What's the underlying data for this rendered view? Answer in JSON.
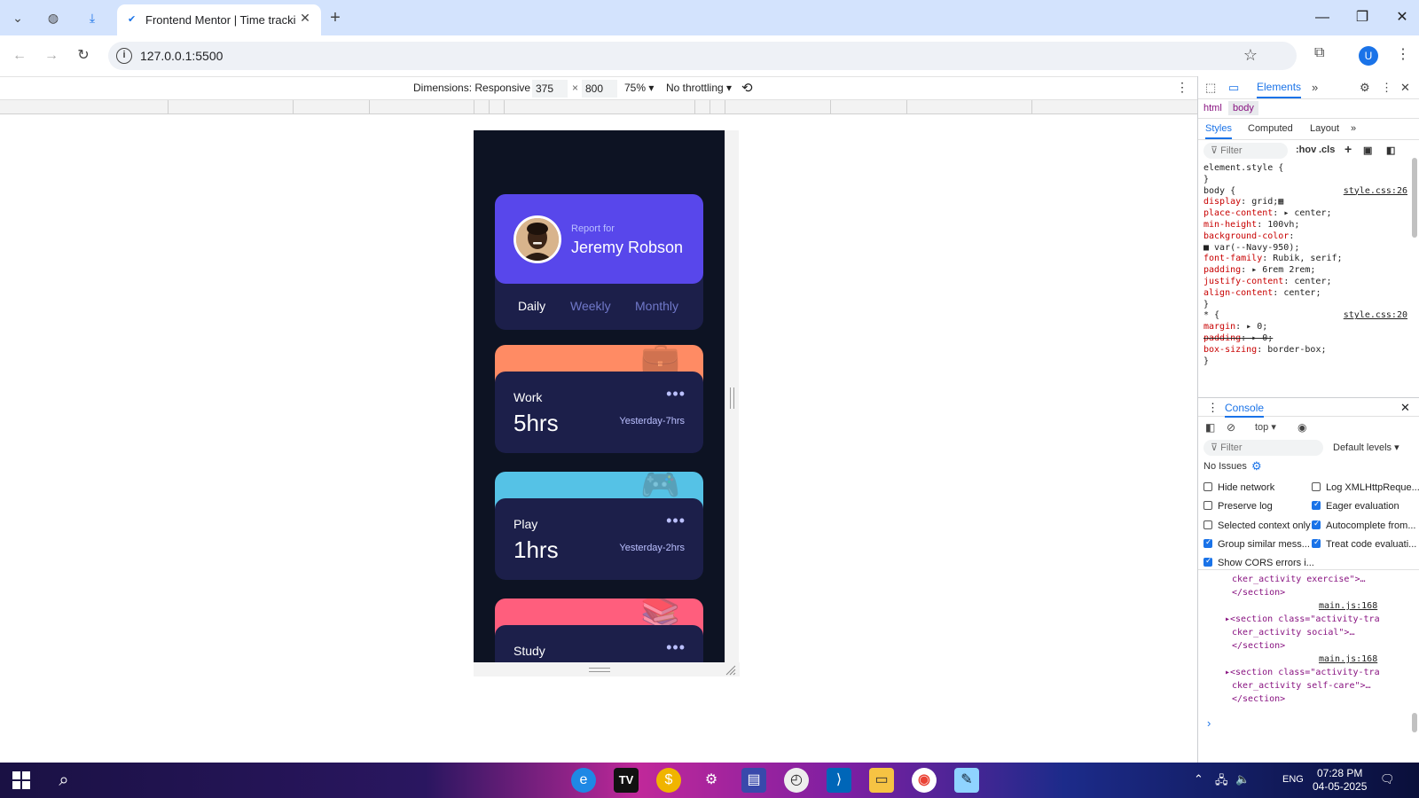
{
  "browser": {
    "tab_title": "Frontend Mentor | Time tracking",
    "url": "127.0.0.1:5500",
    "profile_initial": "U"
  },
  "device_toolbar": {
    "dimensions_label": "Dimensions: Responsive",
    "width": "375",
    "times": "×",
    "height": "800",
    "zoom": "75%",
    "throttling": "No throttling"
  },
  "app": {
    "report_for": "Report for",
    "user_name": "Jeremy Robson",
    "periods": [
      "Daily",
      "Weekly",
      "Monthly"
    ],
    "active_period": "Daily",
    "activities": [
      {
        "name": "Work",
        "hours": "5hrs",
        "previous": "Yesterday-7hrs",
        "color": "#ff8b64",
        "icon": "briefcase-icon"
      },
      {
        "name": "Play",
        "hours": "1hrs",
        "previous": "Yesterday-2hrs",
        "color": "#55c2e6",
        "icon": "gamepad-icon"
      },
      {
        "name": "Study",
        "hours": "",
        "previous": "",
        "color": "#ff5e7d",
        "icon": "book-icon"
      }
    ],
    "colors": {
      "background": "#0d1323",
      "card": "#1c1f4a",
      "accent": "#5847eb"
    }
  },
  "devtools": {
    "panel_tab": "Elements",
    "breadcrumbs": [
      "html",
      "body"
    ],
    "sub_tabs": [
      "Styles",
      "Computed",
      "Layout"
    ],
    "filter_placeholder": "Filter",
    "hov": ":hov",
    "cls": ".cls",
    "css_lines": [
      {
        "text": "element.style {",
        "src": ""
      },
      {
        "text": "}",
        "src": ""
      },
      {
        "text": "body {",
        "src": "style.css:26"
      },
      {
        "text": "  display: grid;▦",
        "src": ""
      },
      {
        "text": "  place-content: ▸ center;",
        "src": ""
      },
      {
        "text": "  min-height: 100vh;",
        "src": ""
      },
      {
        "text": "  background-color:",
        "src": ""
      },
      {
        "text": "    ■ var(--Navy-950);",
        "src": ""
      },
      {
        "text": "  font-family: Rubik, serif;",
        "src": ""
      },
      {
        "text": "  padding: ▸ 6rem 2rem;",
        "src": ""
      },
      {
        "text": "  justify-content: center;",
        "src": ""
      },
      {
        "text": "  align-content: center;",
        "src": ""
      },
      {
        "text": "}",
        "src": ""
      },
      {
        "text": "* {",
        "src": "style.css:20"
      },
      {
        "text": "  margin: ▸ 0;",
        "src": ""
      },
      {
        "text": "  padding: ▸ 0;",
        "src": ""
      },
      {
        "text": "  box-sizing: border-box;",
        "src": ""
      },
      {
        "text": "}",
        "src": ""
      }
    ],
    "console": {
      "title": "Console",
      "context": "top",
      "filter_placeholder": "Filter",
      "levels": "Default levels",
      "no_issues": "No Issues",
      "options_left": [
        {
          "label": "Hide network",
          "checked": false
        },
        {
          "label": "Preserve log",
          "checked": false
        },
        {
          "label": "Selected context only",
          "checked": false
        },
        {
          "label": "Group similar mess...",
          "checked": true
        },
        {
          "label": "Show CORS errors i...",
          "checked": true
        }
      ],
      "options_right": [
        {
          "label": "Log XMLHttpReque...",
          "checked": false
        },
        {
          "label": "Eager evaluation",
          "checked": true
        },
        {
          "label": "Autocomplete from...",
          "checked": true
        },
        {
          "label": "Treat code evaluati...",
          "checked": true
        }
      ],
      "log": [
        {
          "text": "cker_activity exercise\">…",
          "src": ""
        },
        {
          "text": "</section>",
          "src": ""
        },
        {
          "text": "",
          "src": "main.js:168"
        },
        {
          "text": "▸<section class=\"activity-tra",
          "src": ""
        },
        {
          "text": "cker_activity social\">…",
          "src": ""
        },
        {
          "text": "</section>",
          "src": ""
        },
        {
          "text": "",
          "src": "main.js:168"
        },
        {
          "text": "▸<section class=\"activity-tra",
          "src": ""
        },
        {
          "text": "cker_activity self-care\">…",
          "src": ""
        },
        {
          "text": "</section>",
          "src": ""
        }
      ]
    }
  },
  "taskbar": {
    "language": "ENG",
    "time": "07:28 PM",
    "date": "04-05-2025"
  }
}
